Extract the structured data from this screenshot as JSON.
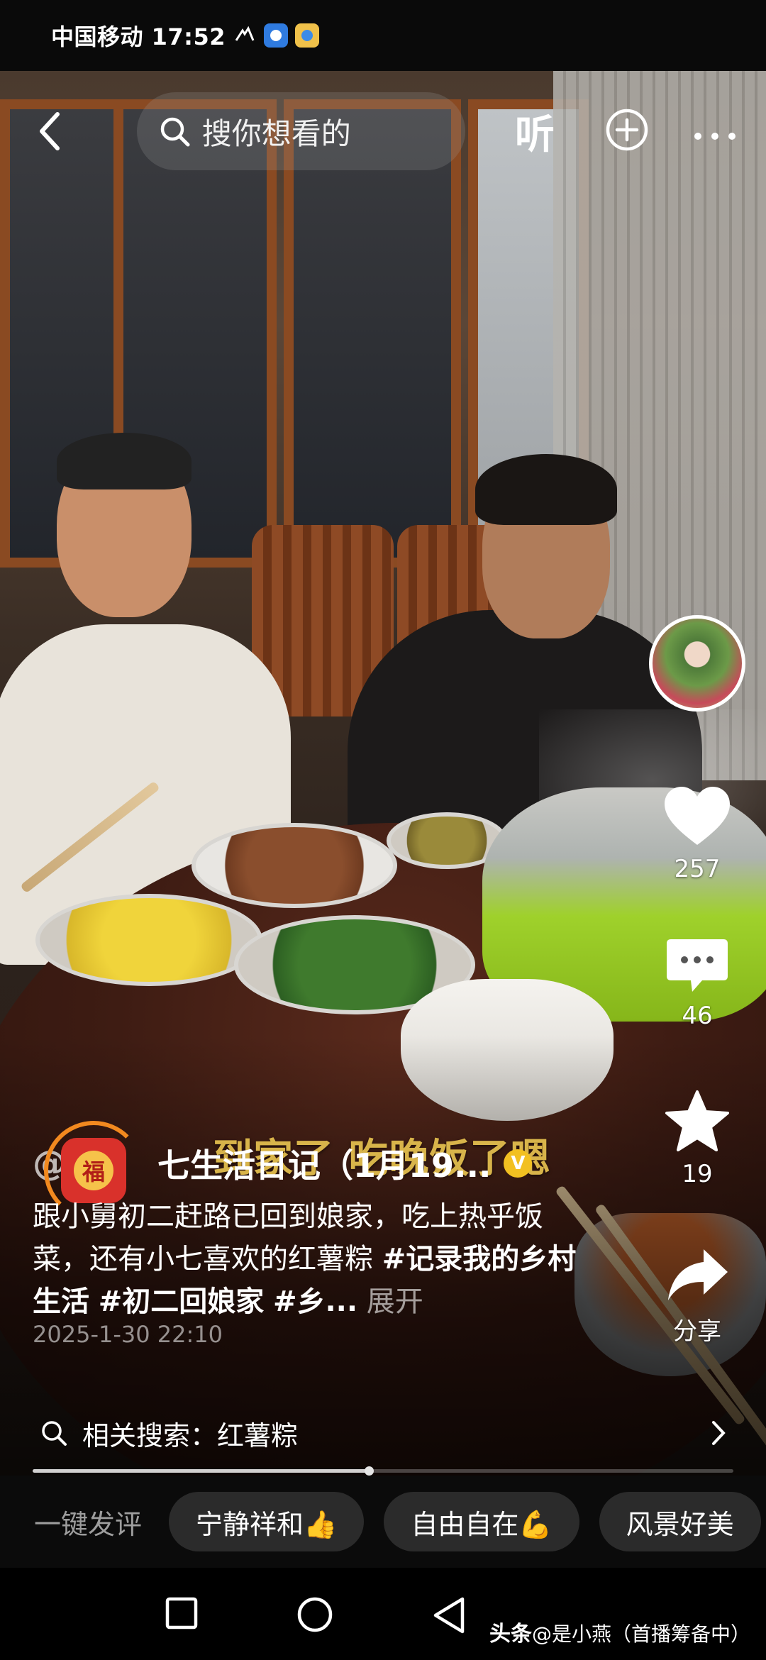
{
  "status_bar": {
    "carrier_time": "中国移动 17:52"
  },
  "top_bar": {
    "search_placeholder": "搜你想看的",
    "listen_label": "听"
  },
  "video": {
    "subtitle": "到家了 吃晚饭了嗯"
  },
  "rail": {
    "likes": "257",
    "comments": "46",
    "favorites": "19",
    "share_label": "分享"
  },
  "post": {
    "author_prefix": "@",
    "author_name": "七生活日记（1月19...",
    "verified_mark": "V",
    "badge_char": "福",
    "desc_text": "跟小舅初二赶路已回到娘家，吃上热乎饭菜，还有小七喜欢的红薯粽 ",
    "tags": [
      "#记录我的乡村生活",
      "#初二回娘家",
      "#乡..."
    ],
    "expand_label": "展开",
    "timestamp": "2025-1-30 22:10"
  },
  "related_search": {
    "label": "相关搜索：红薯粽"
  },
  "progress": {
    "fraction": 0.48
  },
  "quick_comments": {
    "label": "一键发评",
    "chips": [
      "宁静祥和👍",
      "自由自在💪",
      "风景好美"
    ]
  },
  "watermark": {
    "brand": "头条",
    "text": "@是小燕（首播筹备中）"
  },
  "colors": {
    "subtitle": "#d8b44a",
    "verified": "#f2c021",
    "badge_red": "#d9312b",
    "badge_ring": "#f2891f",
    "chip_bg": "#2b2b2b"
  }
}
